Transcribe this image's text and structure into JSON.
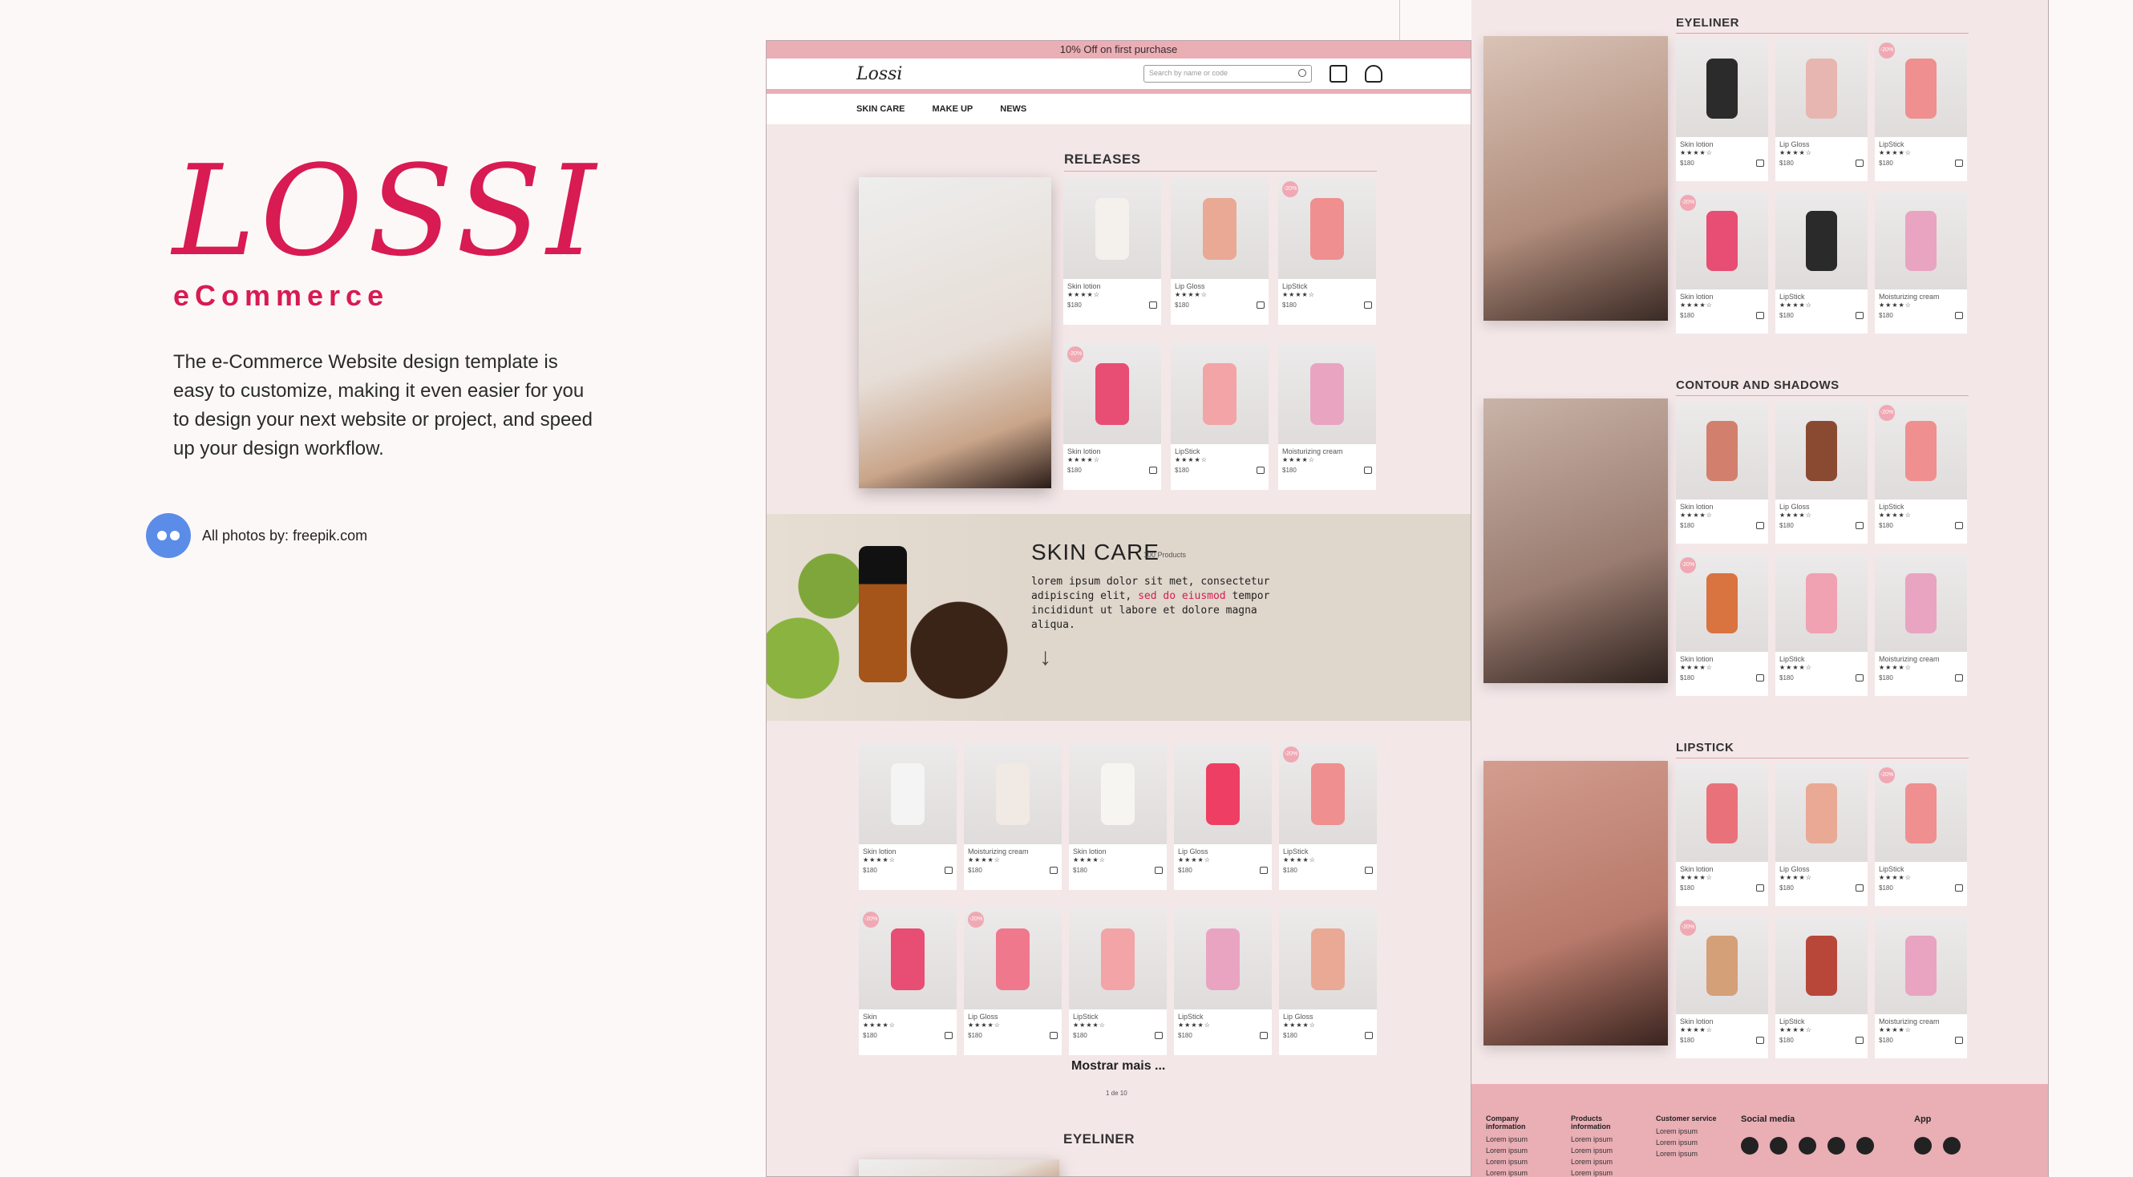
{
  "intro": {
    "brand": "LOSSI",
    "subtitle": "eCommerce",
    "description": "The e-Commerce Website design template is easy to customize, making it even easier for you to design your next website or project, and speed up your design workflow.",
    "credit": "All photos by: freepik.com"
  },
  "site": {
    "promo": "10% Off on first purchase",
    "logo": "Lossi",
    "search_placeholder": "Search by name or code",
    "nav": [
      "SKIN CARE",
      "MAKE UP",
      "NEWS"
    ],
    "releases_title": "RELEASES",
    "banner": {
      "title": "SKIN CARE",
      "count": "100 Products",
      "text_a": "lorem ipsum dolor sit met, consectetur adipiscing elit, ",
      "text_highlight": "sed do eiusmod",
      "text_b": " tempor incididunt ut labore et dolore magna aliqua."
    },
    "show_more": "Mostrar mais ...",
    "pagination": "1 de 10",
    "bottom_section": "EYELINER",
    "price": "$180",
    "rating": "★★★★☆",
    "discount": "-20%"
  },
  "colors": {
    "accent": "#d81b52",
    "pink": "#eaaeb5",
    "bg": "#f4e7e8"
  },
  "releases": [
    {
      "name": "Skin lotion",
      "color": "#f4f1ed"
    },
    {
      "name": "Lip Gloss",
      "color": "#e9a995"
    },
    {
      "name": "LipStick",
      "color": "#ef8f8f",
      "badge": true
    },
    {
      "name": "Skin lotion",
      "color": "#e84d73",
      "badge": true
    },
    {
      "name": "LipStick",
      "color": "#f2a4a6"
    },
    {
      "name": "Moisturizing cream",
      "color": "#e9a4c2"
    }
  ],
  "grid": [
    {
      "name": "Skin lotion",
      "color": "#f4f4f4"
    },
    {
      "name": "Moisturizing cream",
      "color": "#f1e9e3"
    },
    {
      "name": "Skin lotion",
      "color": "#f7f5f2"
    },
    {
      "name": "Lip Gloss",
      "color": "#ee3e63"
    },
    {
      "name": "LipStick",
      "color": "#ef8f8f",
      "badge": true
    },
    {
      "name": "Skin",
      "color": "#e84d73",
      "badge": true
    },
    {
      "name": "Lip Gloss",
      "color": "#f0788d",
      "badge": true
    },
    {
      "name": "LipStick",
      "color": "#f2a4a6"
    },
    {
      "name": "LipStick",
      "color": "#e9a4c2"
    },
    {
      "name": "Lip Gloss",
      "color": "#e9a995"
    }
  ],
  "right": {
    "sections": [
      {
        "title": "EYELINER",
        "items": [
          {
            "name": "Skin lotion",
            "color": "#2b2b2b"
          },
          {
            "name": "Lip Gloss",
            "color": "#e7b6b0"
          },
          {
            "name": "LipStick",
            "color": "#ef8f8f",
            "badge": true
          },
          {
            "name": "Skin lotion",
            "color": "#e84d73",
            "badge": true
          },
          {
            "name": "LipStick",
            "color": "#2a2a2a"
          },
          {
            "name": "Moisturizing cream",
            "color": "#e9a4c2"
          }
        ]
      },
      {
        "title": "CONTOUR AND SHADOWS",
        "items": [
          {
            "name": "Skin lotion",
            "color": "#d27f6e"
          },
          {
            "name": "Lip Gloss",
            "color": "#8a4a32"
          },
          {
            "name": "LipStick",
            "color": "#ef8f8f",
            "badge": true
          },
          {
            "name": "Skin lotion",
            "color": "#d9733f",
            "badge": true
          },
          {
            "name": "LipStick",
            "color": "#f0a1b2"
          },
          {
            "name": "Moisturizing cream",
            "color": "#e9a4c2"
          }
        ]
      },
      {
        "title": "LIPSTICK",
        "items": [
          {
            "name": "Skin lotion",
            "color": "#e9727a"
          },
          {
            "name": "Lip Gloss",
            "color": "#e9a995"
          },
          {
            "name": "LipStick",
            "color": "#ef8f8f",
            "badge": true
          },
          {
            "name": "Skin lotion",
            "color": "#d3a078",
            "badge": true
          },
          {
            "name": "LipStick",
            "color": "#b8473a"
          },
          {
            "name": "Moisturizing cream",
            "color": "#e9a4c2"
          }
        ]
      }
    ],
    "footer": {
      "cols": [
        {
          "title": "Company information",
          "links": [
            "Lorem ipsum",
            "Lorem ipsum",
            "Lorem ipsum",
            "Lorem ipsum"
          ]
        },
        {
          "title": "Products information",
          "links": [
            "Lorem ipsum",
            "Lorem ipsum",
            "Lorem ipsum",
            "Lorem ipsum"
          ]
        },
        {
          "title": "Customer service",
          "links": [
            "Lorem ipsum",
            "Lorem ipsum",
            "Lorem ipsum"
          ]
        }
      ],
      "social_title": "Social media",
      "social": [
        "facebook-icon",
        "instagram-icon",
        "youtube-icon",
        "snapchat-icon",
        "pinterest-icon"
      ],
      "app_title": "App",
      "apps": [
        "apple-icon",
        "android-icon"
      ]
    }
  }
}
